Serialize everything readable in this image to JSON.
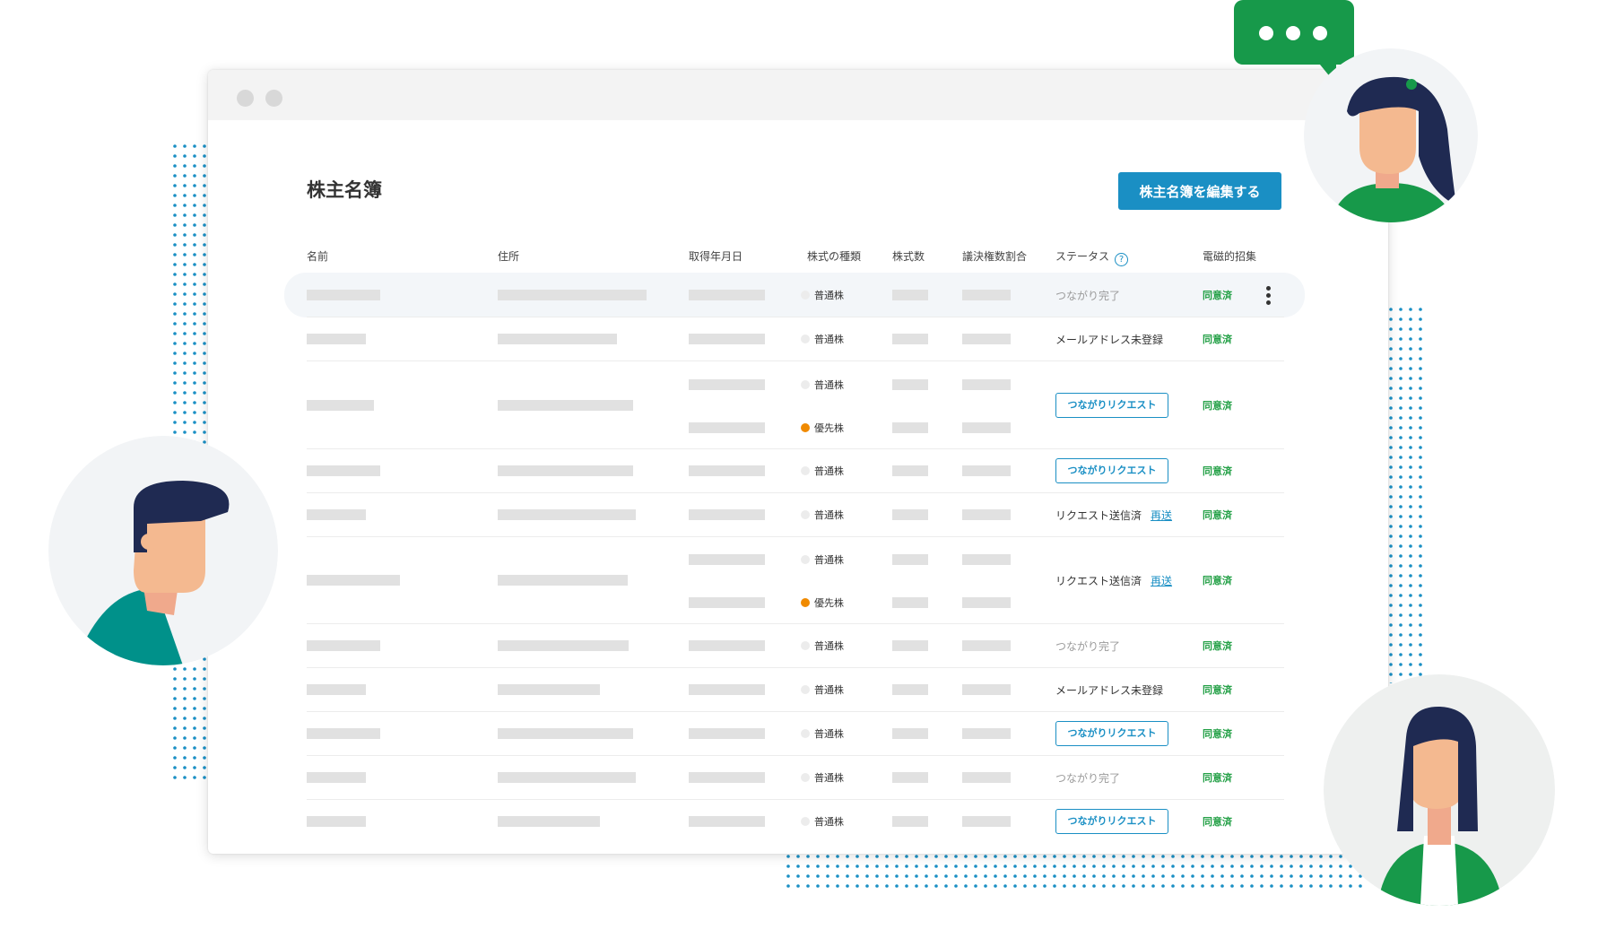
{
  "page": {
    "title": "株主名簿",
    "edit_button": "株主名簿を編集する"
  },
  "columns": {
    "name": "名前",
    "address": "住所",
    "acquired": "取得年月日",
    "share_type": "株式の種類",
    "share_count": "株式数",
    "voting_ratio": "議決権数割合",
    "status": "ステータス",
    "e_notice": "電磁的招集"
  },
  "rows": [
    {
      "shares": [
        {
          "type": "普通株",
          "color": "#ececec"
        }
      ],
      "status": {
        "kind": "muted",
        "text": "つながり完了"
      },
      "consent": "同意済"
    },
    {
      "shares": [
        {
          "type": "普通株",
          "color": "#ececec"
        }
      ],
      "status": {
        "kind": "dark",
        "text": "メールアドレス未登録"
      },
      "consent": "同意済"
    },
    {
      "shares": [
        {
          "type": "普通株",
          "color": "#ececec"
        },
        {
          "type": "優先株",
          "color": "#f08a00"
        }
      ],
      "status": {
        "kind": "button",
        "text": "つながりリクエスト"
      },
      "consent": "同意済"
    },
    {
      "shares": [
        {
          "type": "普通株",
          "color": "#ececec"
        }
      ],
      "status": {
        "kind": "button",
        "text": "つながりリクエスト"
      },
      "consent": "同意済"
    },
    {
      "shares": [
        {
          "type": "普通株",
          "color": "#ececec"
        }
      ],
      "status": {
        "kind": "sent",
        "text": "リクエスト送信済",
        "link": "再送"
      },
      "consent": "同意済"
    },
    {
      "shares": [
        {
          "type": "普通株",
          "color": "#ececec"
        },
        {
          "type": "優先株",
          "color": "#f08a00"
        }
      ],
      "status": {
        "kind": "sent",
        "text": "リクエスト送信済",
        "link": "再送"
      },
      "consent": "同意済"
    },
    {
      "shares": [
        {
          "type": "普通株",
          "color": "#ececec"
        }
      ],
      "status": {
        "kind": "muted",
        "text": "つながり完了"
      },
      "consent": "同意済"
    },
    {
      "shares": [
        {
          "type": "普通株",
          "color": "#ececec"
        }
      ],
      "status": {
        "kind": "dark",
        "text": "メールアドレス未登録"
      },
      "consent": "同意済"
    },
    {
      "shares": [
        {
          "type": "普通株",
          "color": "#ececec"
        }
      ],
      "status": {
        "kind": "button",
        "text": "つながりリクエスト"
      },
      "consent": "同意済"
    },
    {
      "shares": [
        {
          "type": "普通株",
          "color": "#ececec"
        }
      ],
      "status": {
        "kind": "muted",
        "text": "つながり完了"
      },
      "consent": "同意済"
    },
    {
      "shares": [
        {
          "type": "普通株",
          "color": "#ececec"
        }
      ],
      "status": {
        "kind": "button",
        "text": "つながりリクエスト"
      },
      "consent": "同意済"
    }
  ],
  "colors": {
    "accent": "#1a8fc4",
    "consent": "#23a046",
    "chat_bubble": "#17994a",
    "preferred_share": "#f08a00"
  },
  "icons": {
    "help": "question-circle-icon",
    "more": "kebab-menu-icon",
    "chat": "chat-bubble-icon"
  }
}
